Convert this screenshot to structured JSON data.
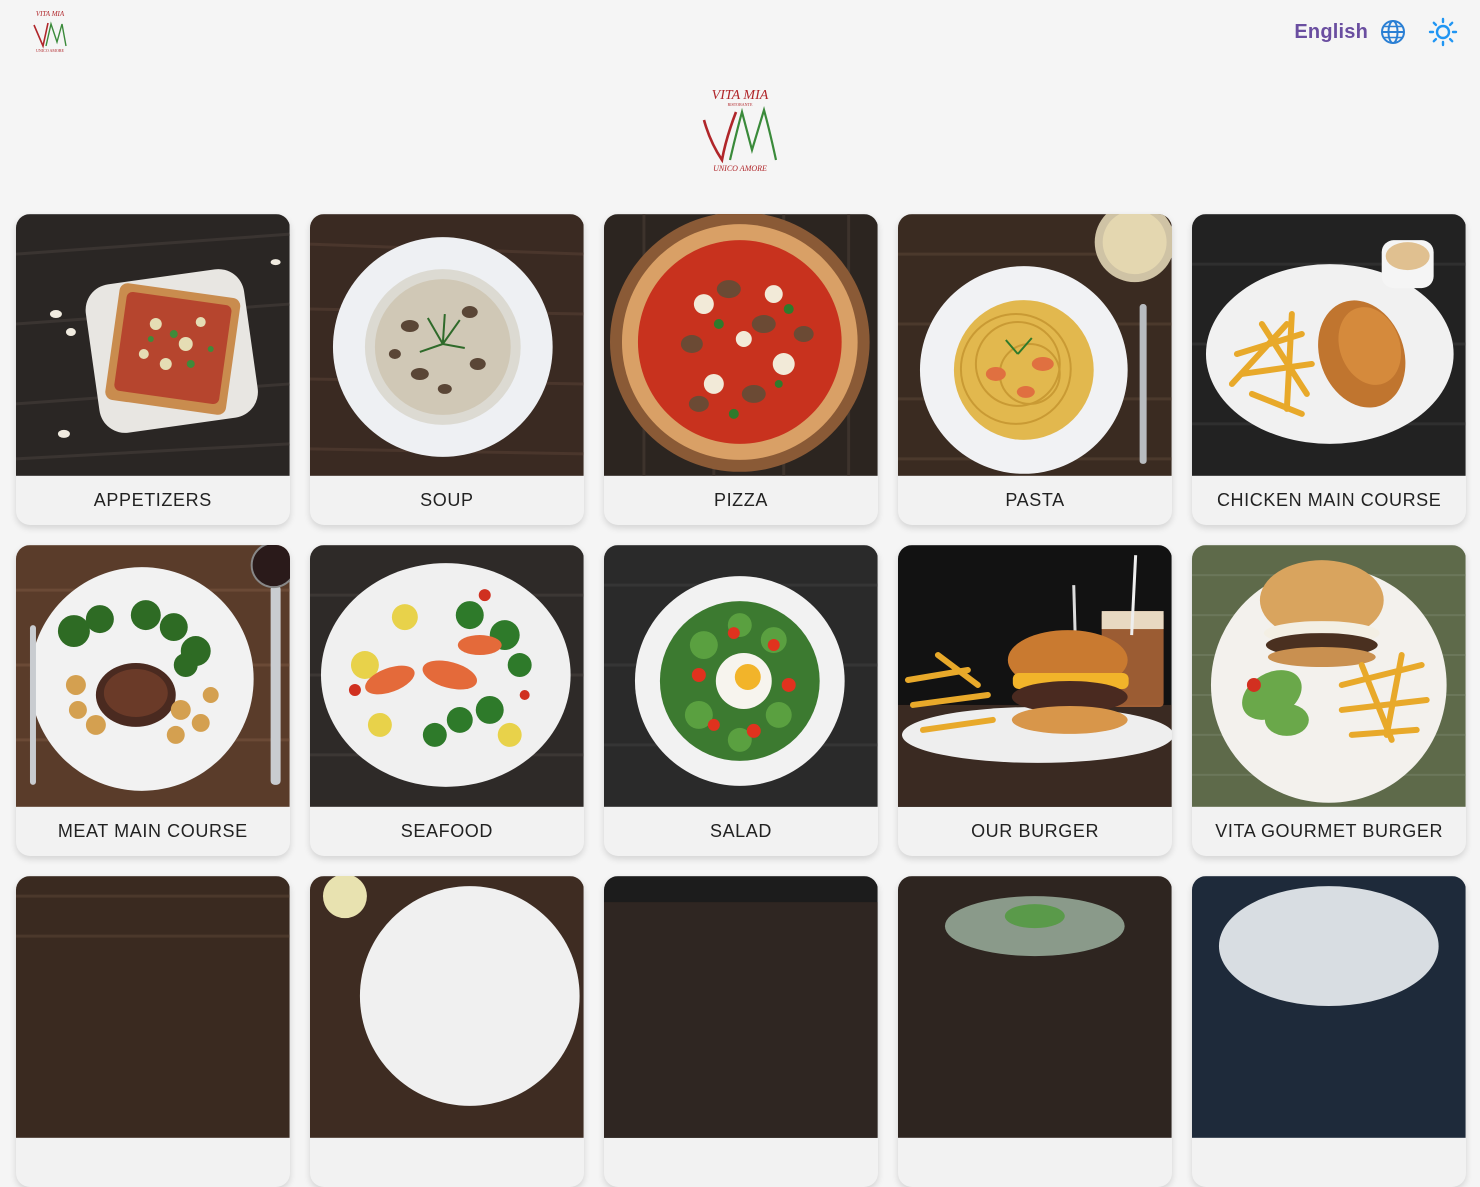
{
  "header": {
    "language_label": "English",
    "logo_brand": "VITA MIA",
    "logo_sub": "RISTORANTE",
    "logo_motto": "UNICO AMORE",
    "logo_mark": "VM"
  },
  "categories": [
    {
      "label": "APPETIZERS"
    },
    {
      "label": "SOUP"
    },
    {
      "label": "PIZZA"
    },
    {
      "label": "PASTA"
    },
    {
      "label": "CHICKEN MAIN COURSE"
    },
    {
      "label": "MEAT MAIN COURSE"
    },
    {
      "label": "SEAFOOD"
    },
    {
      "label": "SALAD"
    },
    {
      "label": "OUR BURGER"
    },
    {
      "label": "VITA GOURMET BURGER"
    },
    {
      "label": ""
    },
    {
      "label": ""
    },
    {
      "label": ""
    },
    {
      "label": ""
    },
    {
      "label": ""
    }
  ],
  "colors": {
    "accent": "#6a4ea0",
    "globe": "#2a7fd4",
    "sun": "#2196f3",
    "logo_red": "#b0262a",
    "logo_green": "#3a8a3a"
  },
  "icons": {
    "language": "globe-icon",
    "theme": "sun-icon"
  }
}
